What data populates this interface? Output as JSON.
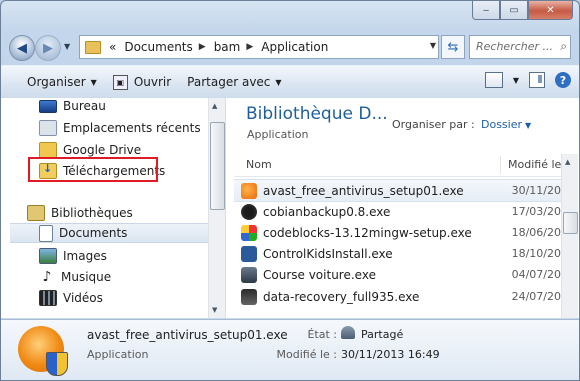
{
  "window": {
    "caption_minimize": "‒",
    "caption_maximize": "▭",
    "caption_close": "✕"
  },
  "address": {
    "crumbs": [
      "Documents",
      "bam",
      "Application"
    ],
    "root_chevron": "«",
    "search_placeholder": "Rechercher ..."
  },
  "toolbar": {
    "organiser": "Organiser",
    "ouvrir": "Ouvrir",
    "partager": "Partager avec"
  },
  "nav": {
    "items": [
      {
        "label": "Bureau",
        "icon": "desktop-icon"
      },
      {
        "label": "Emplacements récents",
        "icon": "recent-places-icon"
      },
      {
        "label": "Google Drive",
        "icon": "google-drive-folder-icon"
      },
      {
        "label": "Téléchargements",
        "icon": "downloads-folder-icon"
      },
      {
        "label": "Bibliothèques",
        "icon": "libraries-icon"
      },
      {
        "label": "Documents",
        "icon": "documents-icon"
      },
      {
        "label": "Images",
        "icon": "pictures-icon"
      },
      {
        "label": "Musique",
        "icon": "music-icon"
      },
      {
        "label": "Vidéos",
        "icon": "videos-icon"
      }
    ]
  },
  "content": {
    "library_title": "Bibliothèque D...",
    "library_subtitle": "Application",
    "organize_by_label": "Organiser par :",
    "organize_by_value": "Dossier",
    "col_name": "Nom",
    "col_modified": "Modifié le",
    "files": [
      {
        "name": "avast_free_antivirus_setup01.exe",
        "date": "30/11/20",
        "icon": "avast-icon"
      },
      {
        "name": "cobianbackup0.8.exe",
        "date": "17/03/20",
        "icon": "cobian-icon"
      },
      {
        "name": "codeblocks-13.12mingw-setup.exe",
        "date": "18/06/20",
        "icon": "codeblocks-icon"
      },
      {
        "name": "ControlKidsInstall.exe",
        "date": "18/10/20",
        "icon": "controlkids-icon"
      },
      {
        "name": "Course voiture.exe",
        "date": "04/07/20",
        "icon": "course-voiture-icon"
      },
      {
        "name": "data-recovery_full935.exe",
        "date": "24/07/20",
        "icon": "data-recovery-icon"
      }
    ]
  },
  "details": {
    "name": "avast_free_antivirus_setup01.exe",
    "type": "Application",
    "state_label": "État :",
    "state_value": "Partagé",
    "modified_label": "Modifié le :",
    "modified_value": "30/11/2013 16:49"
  }
}
